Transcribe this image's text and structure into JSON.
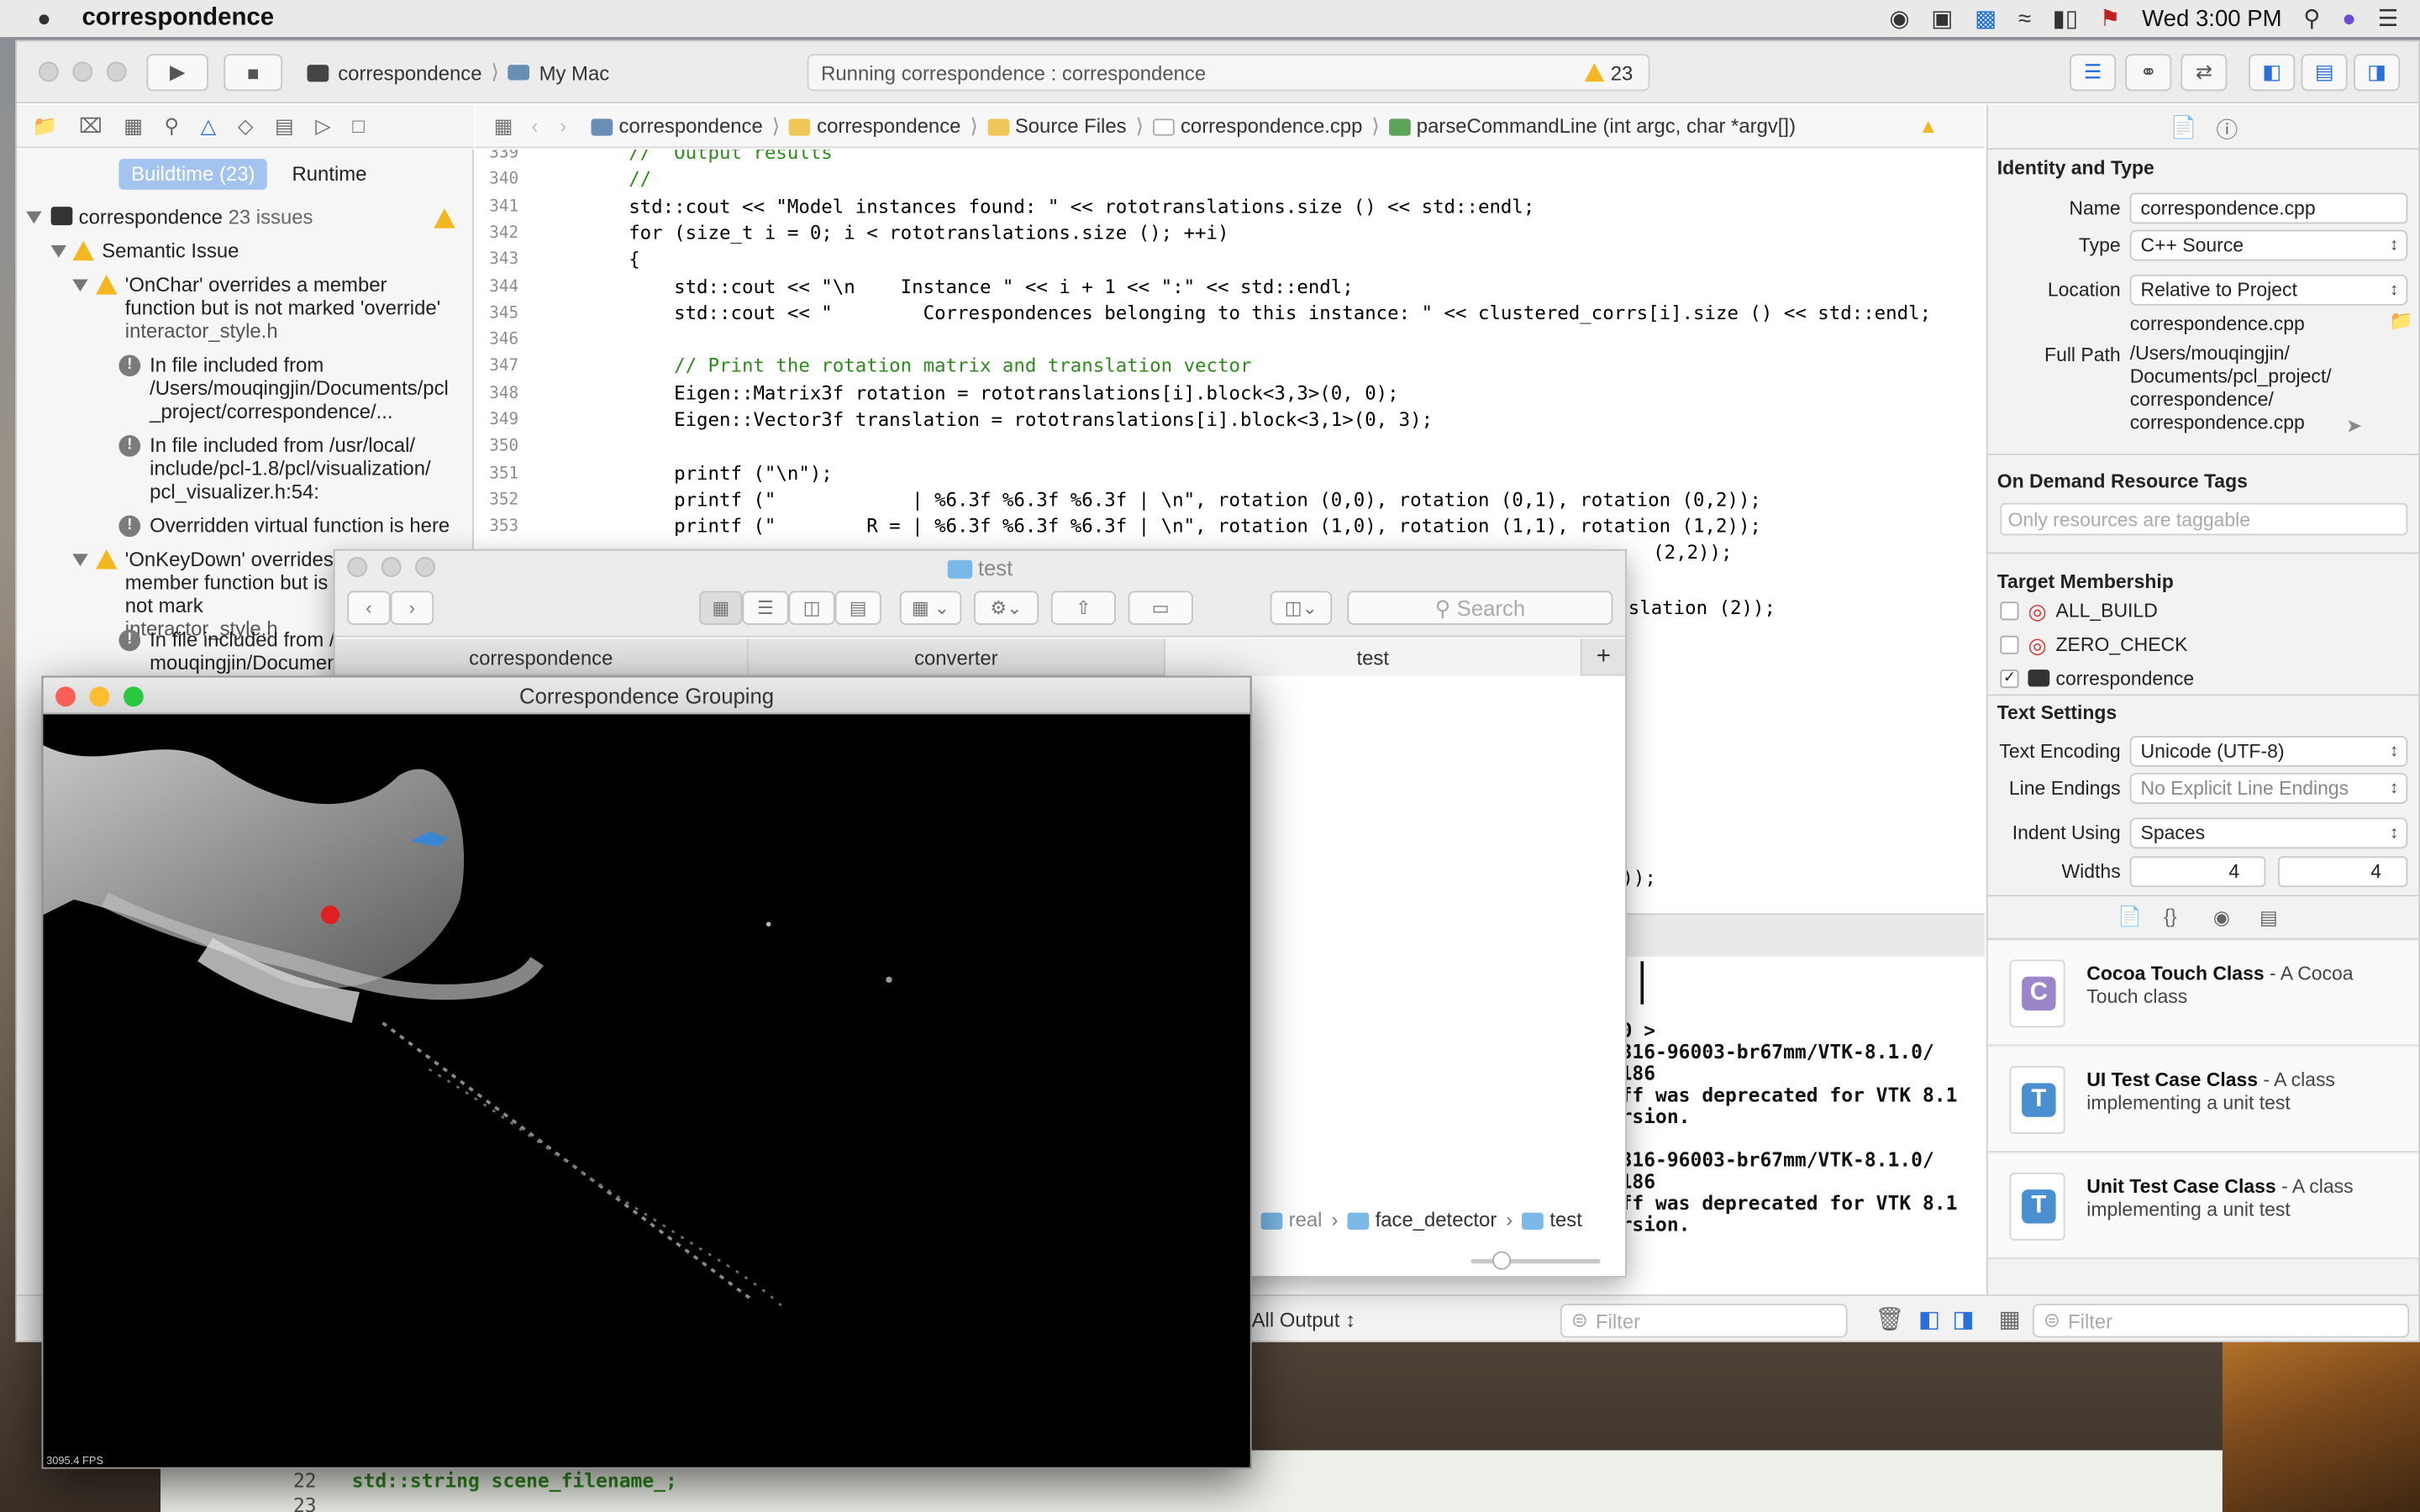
{
  "menubar": {
    "app": "correspondence",
    "clock": "Wed 3:00 PM"
  },
  "toolbar": {
    "scheme": "correspondence",
    "destination": "My Mac",
    "status": "Running correspondence : correspondence",
    "warning_count": "23"
  },
  "navigator": {
    "tabs": [
      "Buildtime (23)",
      "Runtime"
    ],
    "project": "correspondence",
    "project_issues": "23 issues",
    "group": "Semantic Issue",
    "issues": [
      {
        "title": "'OnChar' overrides a member function but is not marked 'override'",
        "file": "interactor_style.h"
      },
      {
        "note": "In file included from /Users/mouqingjin/Documents/pcl _project/correspondence/..."
      },
      {
        "note": "In file included from /usr/local/ include/pcl-1.8/pcl/visualization/ pcl_visualizer.h:54:"
      },
      {
        "note": "Overridden virtual function is here"
      },
      {
        "title": "'OnKeyDown' overrides a member function but is not mark",
        "file": "interactor_style.h"
      },
      {
        "note": "In file included from / mouqingjin/Documen"
      }
    ]
  },
  "jumpbar": {
    "crumbs": [
      "correspondence",
      "correspondence",
      "Source Files",
      "correspondence.cpp",
      "parseCommandLine (int argc, char *argv[])"
    ]
  },
  "editor": {
    "lines": [
      {
        "n": "339",
        "t": "    //  Output results"
      },
      {
        "n": "340",
        "t": "    //"
      },
      {
        "n": "341",
        "t": "    std::cout << \"Model instances found: \" << rototranslations.size () << std::endl;"
      },
      {
        "n": "342",
        "t": "    for (size_t i = 0; i < rototranslations.size (); ++i)"
      },
      {
        "n": "343",
        "t": "    {"
      },
      {
        "n": "344",
        "t": "        std::cout << \"\\n    Instance \" << i + 1 << \":\" << std::endl;"
      },
      {
        "n": "345",
        "t": "        std::cout << \"        Correspondences belonging to this instance: \" << clustered_corrs[i].size () << std::endl;"
      },
      {
        "n": "346",
        "t": ""
      },
      {
        "n": "347",
        "t": "        // Print the rotation matrix and translation vector"
      },
      {
        "n": "348",
        "t": "        Eigen::Matrix3f rotation = rototranslations[i].block<3,3>(0, 0);"
      },
      {
        "n": "349",
        "t": "        Eigen::Vector3f translation = rototranslations[i].block<3,1>(0, 3);"
      },
      {
        "n": "350",
        "t": ""
      },
      {
        "n": "351",
        "t": "        printf (\"\\n\");"
      },
      {
        "n": "352",
        "t": "        printf (\"            | %6.3f %6.3f %6.3f | \\n\", rotation (0,0), rotation (0,1), rotation (0,2));"
      },
      {
        "n": "353",
        "t": "        printf (\"        R = | %6.3f %6.3f %6.3f | \\n\", rotation (1,0), rotation (1,1), rotation (1,2));"
      }
    ],
    "peek_1": "(2,2));",
    "peek_2": "slation (2));",
    "peek_3": "));"
  },
  "console": {
    "lines": [
      "0 >",
      "316-96003-br67mm/VTK-8.1.0/",
      " 186",
      "ff was deprecated for VTK 8.1",
      "rsion.",
      "",
      "316-96003-br67mm/VTK-8.1.0/",
      " 186",
      "ff was deprecated for VTK 8.1",
      "rsion."
    ],
    "output_select": "All Output",
    "filter_placeholder": "Filter"
  },
  "inspector": {
    "identity_title": "Identity and Type",
    "name_label": "Name",
    "name_value": "correspondence.cpp",
    "type_label": "Type",
    "type_value": "C++ Source",
    "location_label": "Location",
    "location_value": "Relative to Project",
    "location_file": "correspondence.cpp",
    "fullpath_label": "Full Path",
    "fullpath_value": [
      "/Users/mouqingjin/",
      "Documents/pcl_project/",
      "correspondence/",
      "correspondence.cpp"
    ],
    "odr_title": "On Demand Resource Tags",
    "odr_placeholder": "Only resources are taggable",
    "target_title": "Target Membership",
    "targets": [
      {
        "name": "ALL_BUILD",
        "checked": false
      },
      {
        "name": "ZERO_CHECK",
        "checked": false
      },
      {
        "name": "correspondence",
        "checked": true
      }
    ],
    "text_title": "Text Settings",
    "encoding_label": "Text Encoding",
    "encoding_value": "Unicode (UTF-8)",
    "endings_label": "Line Endings",
    "endings_value": "No Explicit Line Endings",
    "indent_label": "Indent Using",
    "indent_value": "Spaces",
    "widths_label": "Widths",
    "tab_width": "4",
    "indent_width": "4",
    "library": [
      {
        "title": "Cocoa Touch Class",
        "desc": "A Cocoa Touch class",
        "letter": "C",
        "color": "#9b86c9"
      },
      {
        "title": "UI Test Case Class",
        "desc": "A class implementing a unit test",
        "letter": "T",
        "color": "#4a8fd0"
      },
      {
        "title": "Unit Test Case Class",
        "desc": "A class implementing a unit test",
        "letter": "T",
        "color": "#4a8fd0"
      }
    ],
    "filter_placeholder": "Filter"
  },
  "finder": {
    "title": "test",
    "search_placeholder": "Search",
    "tabs": [
      "correspondence",
      "converter",
      "test"
    ],
    "path": [
      "real",
      "face_detector",
      "test"
    ]
  },
  "vtk": {
    "title": "Correspondence Grouping",
    "fps": "3095.4 FPS"
  },
  "behind": {
    "line_22": "22",
    "line_22_text": "std::string scene_filename_;",
    "line_23": "23"
  },
  "colors": {
    "warning": "#f2b721",
    "accent": "#a4c4f0",
    "comment": "#2f8a1e",
    "keyword": "#1f3fa3",
    "string": "#c41a16"
  }
}
